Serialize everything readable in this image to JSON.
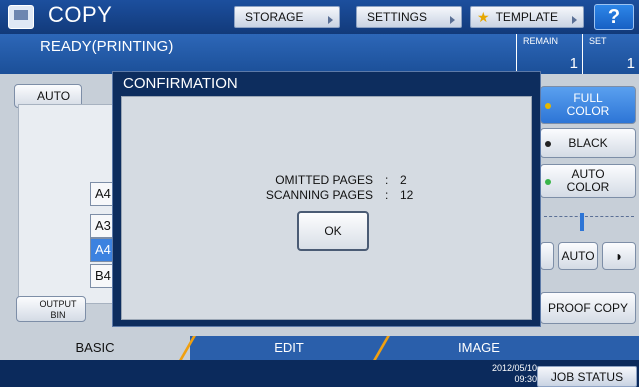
{
  "header": {
    "title": "COPY",
    "storage_label": "STORAGE",
    "settings_label": "SETTINGS",
    "template_label": "TEMPLATE",
    "help_label": "?"
  },
  "status": {
    "text": "READY(PRINTING)",
    "remain_label": "REMAIN",
    "remain_value": "1",
    "set_label": "SET",
    "set_value": "1"
  },
  "left_panel": {
    "auto_label": "AUTO",
    "trays": [
      "A4",
      "A3",
      "A4",
      "B4"
    ],
    "selected_tray_index": 2,
    "output_bin_label_1": "OUTPUT",
    "output_bin_label_2": "BIN"
  },
  "right_panel": {
    "full_color_1": "FULL",
    "full_color_2": "COLOR",
    "black_label": "BLACK",
    "auto_color_1": "AUTO",
    "auto_color_2": "COLOR",
    "density_auto_label": "AUTO",
    "proof_copy_label": "PROOF COPY"
  },
  "dialog": {
    "title": "CONFIRMATION",
    "omitted_label": "OMITTED PAGES",
    "omitted_value": "2",
    "scanning_label": "SCANNING PAGES",
    "scanning_value": "12",
    "separator": ":",
    "ok_label": "OK"
  },
  "tabs": {
    "basic": "BASIC",
    "edit": "EDIT",
    "image": "IMAGE"
  },
  "footer": {
    "date": "2012/05/10",
    "time": "09:30",
    "job_status_label": "JOB STATUS"
  },
  "colors": {
    "accent": "#1c4f9e",
    "tab_divider": "#f0a010",
    "selected_tray": "#3c82e0"
  }
}
